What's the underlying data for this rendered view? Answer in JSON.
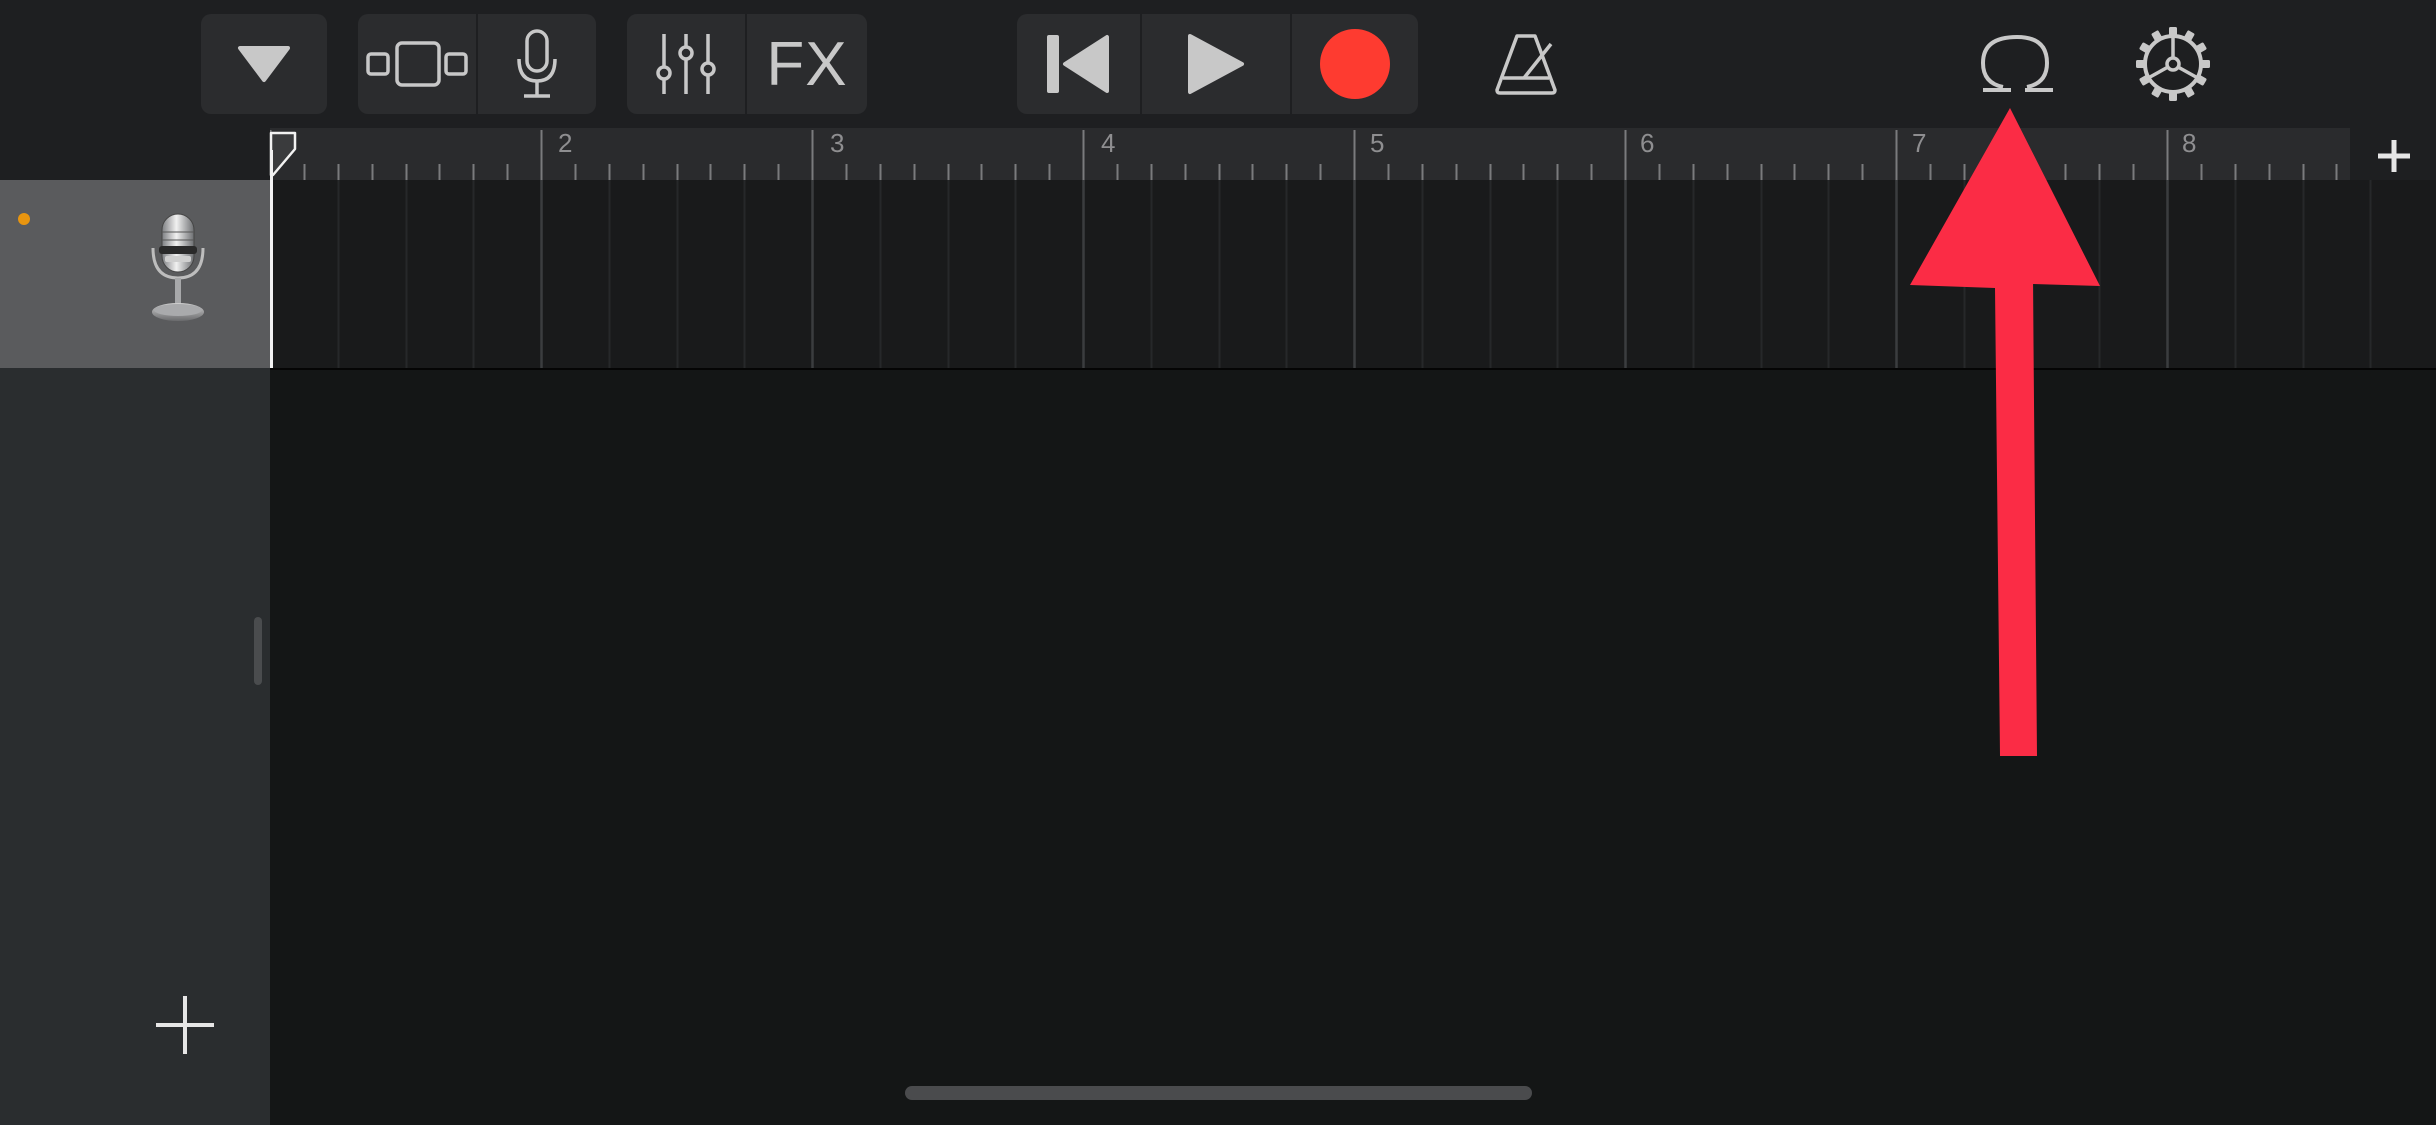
{
  "toolbar": {
    "browser_icon": "triangle-down-icon",
    "tracks_view_icon": "tracks-view-icon",
    "instrument_icon": "microphone-icon",
    "mixer_icon": "sliders-icon",
    "fx_label": "FX",
    "rewind_icon": "skip-back-icon",
    "play_icon": "play-icon",
    "record_icon": "record-icon",
    "metronome_icon": "metronome-icon",
    "loop_icon": "loop-browser-icon",
    "settings_icon": "gear-icon"
  },
  "ruler": {
    "bars": [
      "2",
      "3",
      "4",
      "5",
      "6",
      "7",
      "8"
    ],
    "add_section_icon": "plus-icon"
  },
  "tracks": [
    {
      "name_icon": "studio-microphone-icon",
      "status_color": "#e8950f"
    }
  ],
  "track_column": {
    "add_track_icon": "plus-icon"
  },
  "colors": {
    "record": "#fe3b30",
    "annotation_arrow": "#fb2c45",
    "background": "#141616"
  }
}
